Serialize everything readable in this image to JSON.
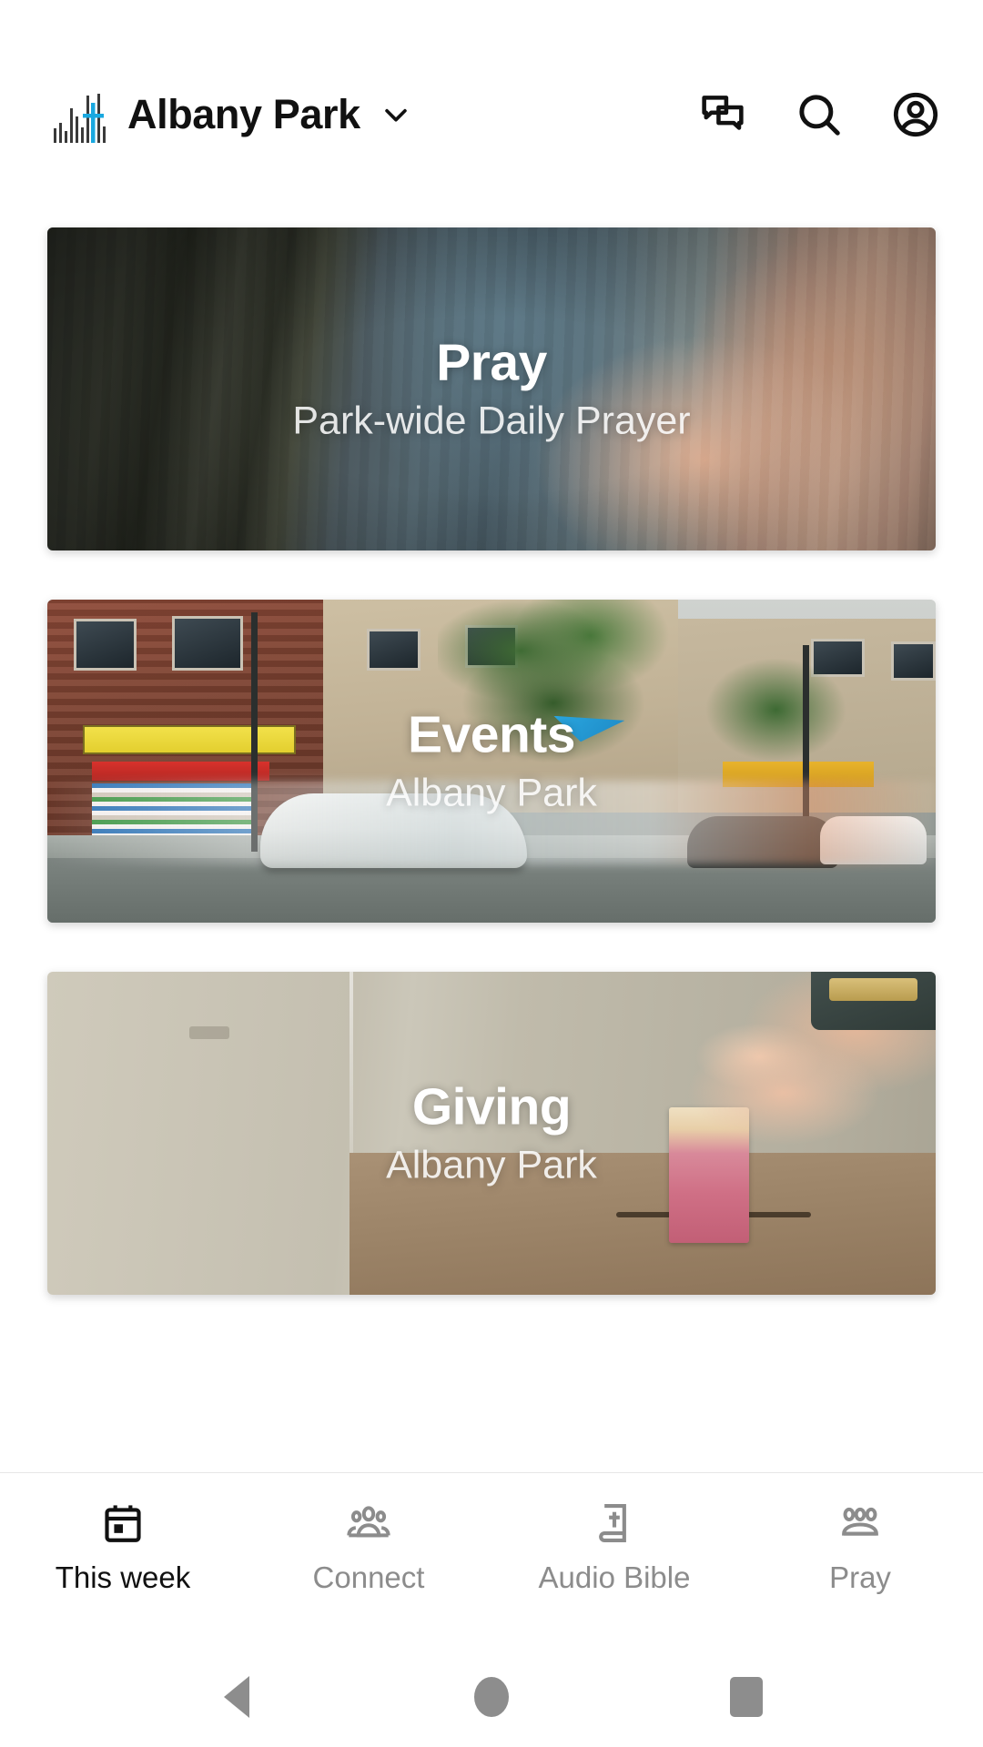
{
  "header": {
    "logo_icon": "skyline-cross-logo",
    "logo_accent_color": "#19A8E0",
    "title": "Albany Park",
    "chevron_icon": "chevron-down-icon",
    "actions": [
      {
        "icon": "chat-bubbles-icon",
        "name": "messages-button"
      },
      {
        "icon": "search-icon",
        "name": "search-button"
      },
      {
        "icon": "account-circle-icon",
        "name": "profile-button"
      }
    ]
  },
  "cards": [
    {
      "id": "pray",
      "title": "Pray",
      "subtitle": "Park-wide Daily Prayer"
    },
    {
      "id": "events",
      "title": "Events",
      "subtitle": "Albany Park"
    },
    {
      "id": "giving",
      "title": "Giving",
      "subtitle": "Albany Park"
    }
  ],
  "tabbar": {
    "active_index": 0,
    "active_color": "#111111",
    "inactive_color": "#8C8C8C",
    "items": [
      {
        "label": "This week",
        "icon": "calendar-icon",
        "active": true
      },
      {
        "label": "Connect",
        "icon": "people-group-icon",
        "active": false
      },
      {
        "label": "Audio Bible",
        "icon": "bible-cross-icon",
        "active": false
      },
      {
        "label": "Pray",
        "icon": "people-group-icon",
        "active": false
      }
    ]
  },
  "system_nav": {
    "back_label": "Back",
    "home_label": "Home",
    "recents_label": "Recent apps"
  }
}
